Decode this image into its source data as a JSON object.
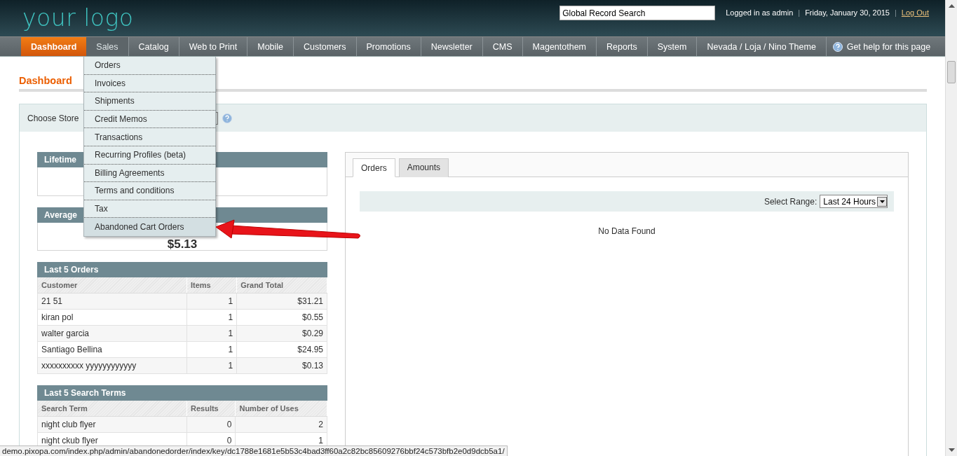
{
  "header": {
    "logo": "your logo",
    "search": {
      "value": "Global Record Search"
    },
    "account": [
      {
        "kind": "text",
        "text": "Logged in as admin"
      },
      {
        "kind": "separator",
        "text": "|"
      },
      {
        "kind": "text",
        "text": "Friday, January 30, 2015"
      },
      {
        "kind": "separator",
        "text": "|"
      },
      {
        "kind": "link",
        "text": "Log Out"
      }
    ]
  },
  "nav": {
    "items": [
      {
        "label": "Dashboard",
        "selected": true,
        "expanded": false
      },
      {
        "label": "Sales",
        "selected": false,
        "expanded": true
      },
      {
        "label": "Catalog",
        "selected": false,
        "expanded": false
      },
      {
        "label": "Web to Print",
        "selected": false,
        "expanded": false
      },
      {
        "label": "Mobile",
        "selected": false,
        "expanded": false
      },
      {
        "label": "Customers",
        "selected": false,
        "expanded": false
      },
      {
        "label": "Promotions",
        "selected": false,
        "expanded": false
      },
      {
        "label": "Newsletter",
        "selected": false,
        "expanded": false
      },
      {
        "label": "CMS",
        "selected": false,
        "expanded": false
      },
      {
        "label": "Magentothem",
        "selected": false,
        "expanded": false
      },
      {
        "label": "Reports",
        "selected": false,
        "expanded": false
      },
      {
        "label": "System",
        "selected": false,
        "expanded": false
      },
      {
        "label": "Nevada / Loja / Nino Theme",
        "selected": false,
        "expanded": false
      }
    ],
    "help": "Get help for this page"
  },
  "sales_menu": [
    {
      "label": "Orders",
      "hovered": false
    },
    {
      "label": "Invoices",
      "hovered": false
    },
    {
      "label": "Shipments",
      "hovered": false
    },
    {
      "label": "Credit Memos",
      "hovered": false
    },
    {
      "label": "Transactions",
      "hovered": false
    },
    {
      "label": "Recurring Profiles (beta)",
      "hovered": false
    },
    {
      "label": "Billing Agreements",
      "hovered": false
    },
    {
      "label": "Terms and conditions",
      "hovered": false
    },
    {
      "label": "Tax",
      "hovered": false
    },
    {
      "label": "Abandoned Cart Orders",
      "hovered": true
    }
  ],
  "page": {
    "title": "Dashboard",
    "store_switcher": {
      "label": "Choose Store"
    },
    "stats": [
      {
        "title": "Lifetime"
      },
      {
        "title": "Average",
        "value": "$5.13"
      }
    ],
    "last_orders": {
      "title": "Last 5 Orders",
      "columns": [
        "Customer",
        "Items",
        "Grand Total"
      ],
      "rows": [
        [
          "21 51",
          "1",
          "$31.21"
        ],
        [
          "kiran pol",
          "1",
          "$0.55"
        ],
        [
          "walter garcia",
          "1",
          "$0.29"
        ],
        [
          "Santiago Bellina",
          "1",
          "$24.95"
        ],
        [
          "xxxxxxxxxx yyyyyyyyyyyy",
          "1",
          "$0.13"
        ]
      ]
    },
    "search_terms": {
      "title": "Last 5 Search Terms",
      "columns": [
        "Search Term",
        "Results",
        "Number of Uses"
      ],
      "rows": [
        [
          "night club flyer",
          "0",
          "2"
        ],
        [
          "night ckub flyer",
          "0",
          "1"
        ]
      ]
    },
    "chart_panel": {
      "tabs": [
        {
          "label": "Orders",
          "selected": true
        },
        {
          "label": "Amounts",
          "selected": false
        }
      ],
      "range_label": "Select Range:",
      "range_value": "Last 24 Hours",
      "message": "No Data Found"
    }
  },
  "status_url": "demo.pixopa.com/index.php/admin/abandonedorder/index/key/dc1788e1681e5b53c4bad3ff60a2c82bc85609276bbf24c573bfb2e0d9dcb5a1/"
}
